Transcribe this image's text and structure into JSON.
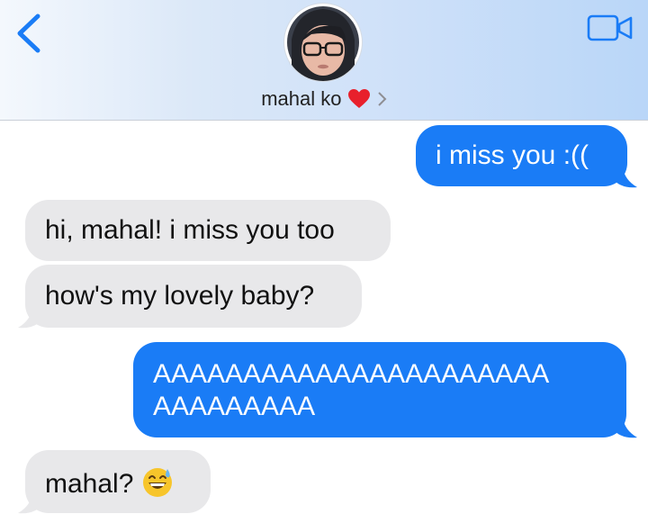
{
  "header": {
    "contact_name": "mahal ko",
    "back_icon": "chevron-left-icon",
    "video_icon": "video-camera-icon",
    "heart_icon": "red-heart-icon",
    "chevron_icon": "chevron-right-icon",
    "accent_color": "#1a7cf6"
  },
  "messages": [
    {
      "direction": "outgoing",
      "text": "i miss you :(("
    },
    {
      "direction": "incoming",
      "text": "hi, mahal! i miss you too"
    },
    {
      "direction": "incoming",
      "text": "how's my lovely baby?"
    },
    {
      "direction": "outgoing",
      "text": "AAAAAAAAAAAAAAAAAAAAAA",
      "text_line2": "AAAAAAAAA"
    },
    {
      "direction": "incoming",
      "text": "mahal?",
      "emoji": "grinning-sweat-emoji"
    }
  ],
  "colors": {
    "outgoing_bubble": "#1a7cf6",
    "incoming_bubble": "#e8e8ea"
  }
}
